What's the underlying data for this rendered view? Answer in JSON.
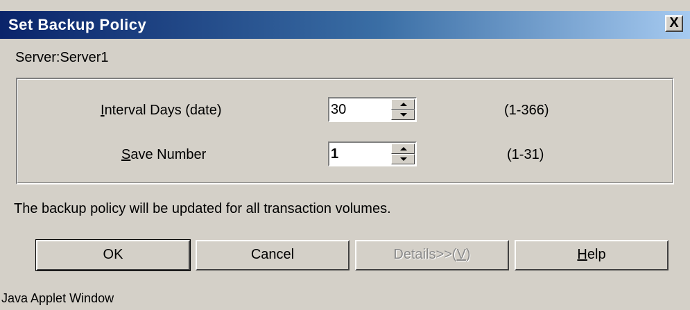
{
  "window": {
    "title": "Set Backup Policy",
    "close_label": "X"
  },
  "server": {
    "label": "Server:Server1"
  },
  "fields": {
    "interval": {
      "mnemonic": "I",
      "label_rest": "nterval Days (date)",
      "value": "30",
      "range": "(1-366)"
    },
    "save": {
      "mnemonic": "S",
      "label_rest": "ave Number",
      "value": "1",
      "range": "(1-31)"
    }
  },
  "info": {
    "text": "The backup policy will be updated for all transaction volumes."
  },
  "buttons": {
    "ok": "OK",
    "cancel": "Cancel",
    "details_prefix": "Details>>(",
    "details_mnemonic": "V",
    "details_suffix": ")",
    "help_mnemonic": "H",
    "help_rest": "elp"
  },
  "footer": {
    "text": "Java Applet Window"
  }
}
